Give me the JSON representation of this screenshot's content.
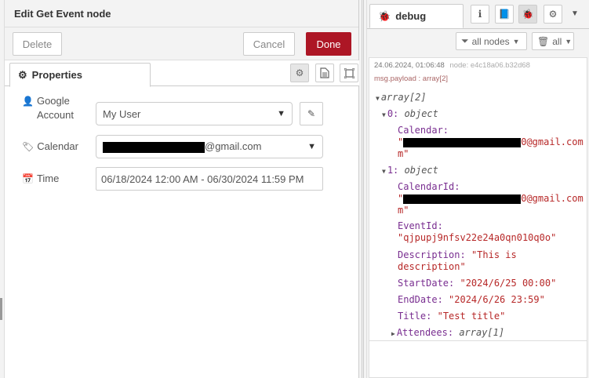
{
  "editor": {
    "title": "Edit Get Event node",
    "delete_label": "Delete",
    "cancel_label": "Cancel",
    "done_label": "Done",
    "tab_properties": "Properties",
    "fields": {
      "account_label": "Google Account",
      "account_label_line1": "Google",
      "account_label_line2": "Account",
      "account_value": "My User",
      "calendar_label": "Calendar",
      "calendar_value_suffix": "@gmail.com",
      "time_label": "Time",
      "time_value": "06/18/2024 12:00 AM - 06/30/2024 11:59 PM"
    }
  },
  "debug": {
    "tab_label": "debug",
    "filter_nodes_label": "all nodes",
    "clear_label": "all",
    "message": {
      "timestamp": "24.06.2024, 01:06:48",
      "node": "node: e4c18a06.b32d68",
      "path": "msg.payload : array[2]",
      "root_label": "array[2]",
      "item0_key": "0:",
      "item0_type": "object",
      "item0_cal_key": "Calendar:",
      "item0_cal_val_suffix": "0@gmail.com",
      "item0_cal_val_end": "m\"",
      "item1_key": "1:",
      "item1_type": "object",
      "cal_id_key": "CalendarId:",
      "cal_id_val_suffix": "0@gmail.com",
      "cal_id_val_end": "m\"",
      "event_id_key": "EventId:",
      "event_id_val": "\"qjpupj9nfsv22e24a0qn010q0o\"",
      "desc_key": "Description:",
      "desc_val_line1": "\"This is",
      "desc_val_line2": "description\"",
      "start_key": "StartDate:",
      "start_val": "\"2024/6/25 00:00\"",
      "end_key": "EndDate:",
      "end_val": "\"2024/6/26 23:59\"",
      "title_key": "Title:",
      "title_val": "\"Test title\"",
      "attendees_key": "Attendees:",
      "attendees_type": "array[1]"
    }
  },
  "colors": {
    "done": "#ad1625",
    "key": "#792e90",
    "string": "#b72828"
  }
}
